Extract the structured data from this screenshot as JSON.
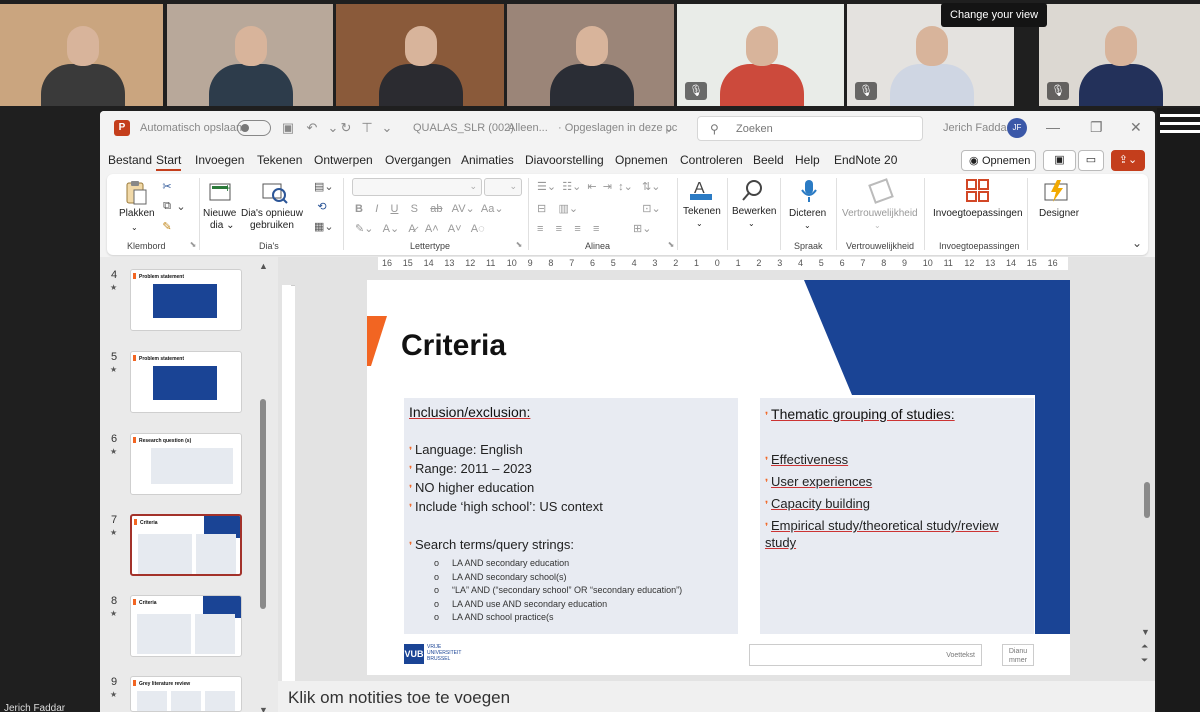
{
  "meeting": {
    "tooltip": "Change your view",
    "participants": [
      {
        "name": "participant-1",
        "bg": "#caa57f",
        "shirt": "#3a3a3a"
      },
      {
        "name": "participant-2",
        "bg": "#b8a89a",
        "shirt": "#2d3c4b"
      },
      {
        "name": "participant-3",
        "bg": "#8a5a3a",
        "shirt": "#2b2b30"
      },
      {
        "name": "participant-4",
        "bg": "#9b8578",
        "shirt": "#2a2d35"
      },
      {
        "name": "participant-5",
        "bg": "#e9ece8",
        "shirt": "#cc4a3c"
      },
      {
        "name": "participant-6",
        "bg": "#e4e2df",
        "shirt": "#cfd6e3"
      },
      {
        "name": "participant-7",
        "bg": "#dcd8d2",
        "shirt": "#23315a"
      }
    ],
    "self_name": "Jerich Faddar"
  },
  "window": {
    "autosave_label": "Automatisch opslaan",
    "doc_title": "QUALAS_SLR (002)",
    "doc_status1": "Alleen...",
    "doc_status2": "Opgeslagen in deze pc",
    "search_placeholder": "Zoeken",
    "user_name": "Jerich Faddar",
    "user_initials": "JF"
  },
  "tabs": [
    "Bestand",
    "Start",
    "Invoegen",
    "Tekenen",
    "Ontwerpen",
    "Overgangen",
    "Animaties",
    "Diavoorstelling",
    "Opnemen",
    "Controleren",
    "Beeld",
    "Help",
    "EndNote 20"
  ],
  "record_button": "Opnemen",
  "ribbon": {
    "paste": "Plakken",
    "clipboard_group": "Klembord",
    "new_slide": "Nieuwe",
    "new_slide2": "dia",
    "reuse": "Dia's opnieuw",
    "reuse2": "gebruiken",
    "slides_group": "Dia's",
    "font_group": "Lettertype",
    "paragraph_group": "Alinea",
    "draw": "Tekenen",
    "edit": "Bewerken",
    "dictate": "Dicteren",
    "voice_group": "Spraak",
    "sensitivity": "Vertrouwelijkheid",
    "sensitivity_group": "Vertrouwelijkheid",
    "addins": "Invoegtoepassingen",
    "addins_group": "Invoegtoepassingen",
    "designer": "Designer"
  },
  "ruler_numbers": [
    "16",
    "15",
    "14",
    "13",
    "12",
    "11",
    "10",
    "9",
    "8",
    "7",
    "6",
    "5",
    "4",
    "3",
    "2",
    "1",
    "0",
    "1",
    "2",
    "3",
    "4",
    "5",
    "6",
    "7",
    "8",
    "9",
    "10",
    "11",
    "12",
    "13",
    "14",
    "15",
    "16"
  ],
  "thumbnails": [
    {
      "num": "4",
      "title": "Problem statement"
    },
    {
      "num": "5",
      "title": "Problem statement"
    },
    {
      "num": "6",
      "title": "Research question (s)"
    },
    {
      "num": "7",
      "title": "Criteria"
    },
    {
      "num": "8",
      "title": "Criteria"
    },
    {
      "num": "9",
      "title": "Grey literature review"
    }
  ],
  "slide": {
    "title": "Criteria",
    "left_heading": "Inclusion/exclusion:",
    "left_items": [
      "Language: English",
      "Range: 2011 – 2023",
      " NO higher education",
      "Include ‘high school’: US context"
    ],
    "search_heading": "Search terms/query strings:",
    "search_items": [
      "LA AND secondary education",
      "LA AND secondary school(s)",
      "“LA” AND (“secondary school” OR “secondary education”)",
      "LA AND use AND secondary education",
      "LA AND school practice(s"
    ],
    "right_heading": "Thematic grouping  of studies:",
    "right_items": [
      "Effectiveness",
      "User experiences",
      "Capacity building",
      "Empirical study/theoretical study/review study"
    ],
    "logo_text": "VUB",
    "logo_sub1": "VRIJE",
    "logo_sub2": "UNIVERSITEIT",
    "logo_sub3": "BRUSSEL",
    "footer": "Voettekst",
    "date1": "Dianu",
    "date2": "mmer"
  },
  "notes_placeholder": "Klik om notities toe te voegen",
  "colors": {
    "accent": "#c43e1c",
    "vub_blue": "#1a4495",
    "vub_orange": "#f26522"
  }
}
